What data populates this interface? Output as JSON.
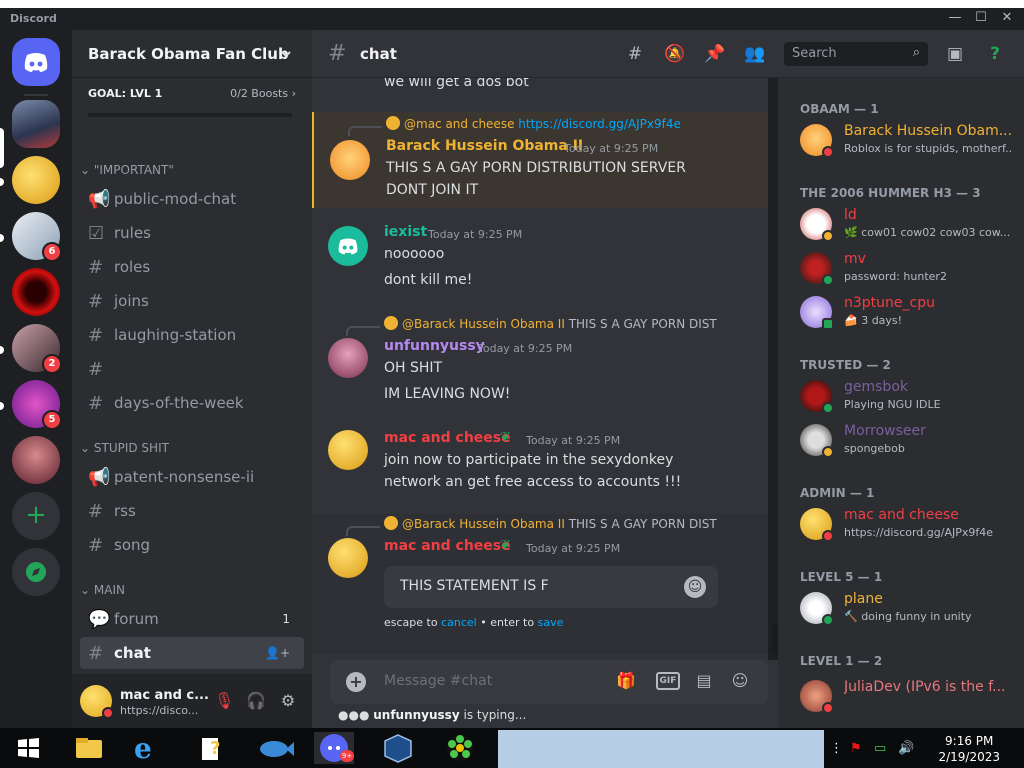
{
  "window": {
    "app_name": "Discord",
    "controls": [
      "—",
      "☐",
      "✕"
    ]
  },
  "server": {
    "name": "Barack Obama Fan Club",
    "boost_goal": "GOAL: LVL 1",
    "boost_count": "0/2 Boosts"
  },
  "guild_badges": [
    "6",
    "2",
    "5"
  ],
  "channels": {
    "categories": [
      "\"IMPORTANT\"",
      "STUPID SHIT",
      "MAIN"
    ],
    "items": [
      {
        "name": "public-mod-chat"
      },
      {
        "name": "rules"
      },
      {
        "name": "roles"
      },
      {
        "name": "joins"
      },
      {
        "name": "laughing-station"
      },
      {
        "name": ""
      },
      {
        "name": "days-of-the-week"
      },
      {
        "name": "patent-nonsense-ii"
      },
      {
        "name": "rss"
      },
      {
        "name": "song"
      },
      {
        "name": "forum",
        "count": "1"
      },
      {
        "name": "chat",
        "active": true
      }
    ]
  },
  "user_panel": {
    "name": "mac and c...",
    "status": "https://disco..."
  },
  "header": {
    "channel": "chat",
    "search_placeholder": "Search"
  },
  "messages": {
    "top_fragment": "we will get a dos bot",
    "m1": {
      "reply_author": "@mac and cheese",
      "reply_link": "https://discord.gg/AJPx9f4e",
      "author": "Barack Hussein Obama II",
      "timestamp": "Today at 9:25 PM",
      "lines": [
        "THIS S A GAY PORN DISTRIBUTION SERVER",
        "DONT JOIN IT"
      ]
    },
    "m2": {
      "author": "iexist",
      "timestamp": "Today at 9:25 PM",
      "lines": [
        "noooooo",
        "dont kill me!"
      ]
    },
    "m3": {
      "reply_author": "@Barack Hussein Obama II",
      "reply_text": "THIS S A GAY PORN DIST",
      "author": "unfunnyussy",
      "timestamp": "Today at 9:25 PM",
      "lines": [
        "OH SHIT",
        "IM LEAVING NOW!"
      ]
    },
    "m4": {
      "author": "mac and cheese",
      "timestamp": "Today at 9:25 PM",
      "lines": [
        "join now to participate in the sexydonkey",
        "network an get free access to accounts !!!"
      ]
    },
    "m5": {
      "reply_author": "@Barack Hussein Obama II",
      "reply_text": "THIS S A GAY PORN DIST",
      "author": "mac and cheese",
      "timestamp": "Today at 9:25 PM",
      "edit_value": "THIS STATEMENT IS F",
      "hint_escape": "escape to",
      "hint_cancel": "cancel",
      "hint_mid": "• enter to",
      "hint_save": "save"
    }
  },
  "composer": {
    "placeholder": "Message #chat",
    "gif_label": "GIF",
    "typing_user": "unfunnyussy",
    "typing_suffix": "is typing..."
  },
  "members": {
    "groups": [
      {
        "title": "OBAAM — 1",
        "members": [
          {
            "name": "Barack Hussein Obam...",
            "status": "Roblox is for stupids, motherf...",
            "color": "#f0b232"
          }
        ]
      },
      {
        "title": "THE 2006 HUMMER H3 — 3",
        "members": [
          {
            "name": "ld",
            "status": "cow01 cow02 cow03 cow...",
            "color": "#f23f43"
          },
          {
            "name": "mv",
            "status": "password: hunter2",
            "color": "#f23f43"
          },
          {
            "name": "n3ptune_cpu",
            "status": "3 days!",
            "color": "#f23f43"
          }
        ]
      },
      {
        "title": "TRUSTED — 2",
        "members": [
          {
            "name": "gemsbok",
            "status": "Playing NGU IDLE",
            "color": "#7a5f9e"
          },
          {
            "name": "Morrowseer",
            "status": "spongebob",
            "color": "#7a5f9e"
          }
        ]
      },
      {
        "title": "ADMIN — 1",
        "members": [
          {
            "name": "mac and cheese",
            "status": "https://discord.gg/AJPx9f4e",
            "color": "#f23f43"
          }
        ]
      },
      {
        "title": "LEVEL 5 — 1",
        "members": [
          {
            "name": "plane",
            "status": "doing funny in unity",
            "color": "#f0b232"
          }
        ]
      },
      {
        "title": "LEVEL 1 — 2",
        "members": [
          {
            "name": "JuliaDev (IPv6 is the f...",
            "status": "",
            "color": "#e6787b"
          }
        ]
      }
    ]
  },
  "taskbar": {
    "time": "9:16 PM",
    "date": "2/19/2023"
  },
  "colors": {
    "obama_gold": "#f0b232",
    "iexist_teal": "#1abc9c",
    "unfunny_purple": "#b589f0",
    "mac_red": "#f23f43",
    "link_blue": "#00a8fc"
  }
}
